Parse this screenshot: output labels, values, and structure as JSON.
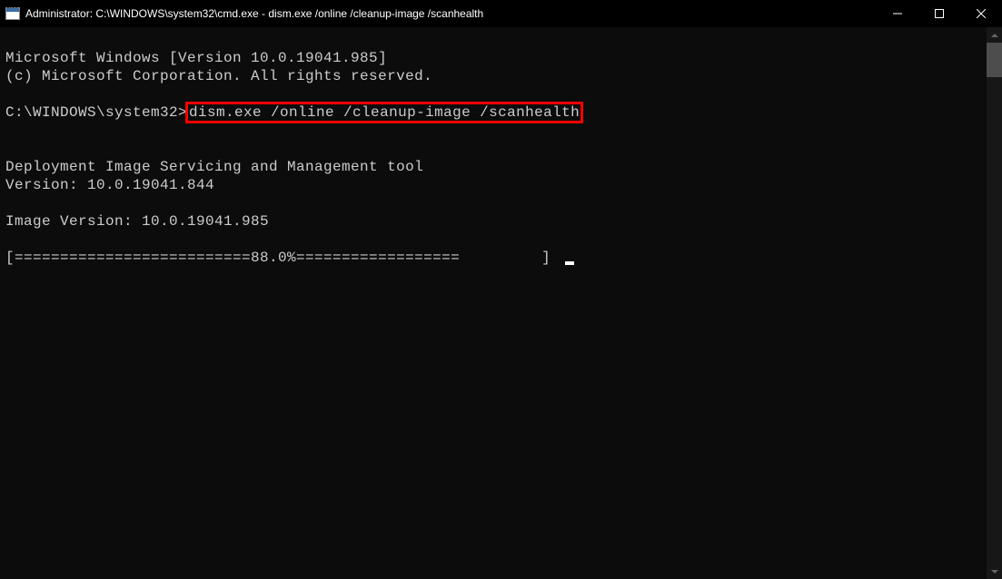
{
  "window": {
    "title": "Administrator: C:\\WINDOWS\\system32\\cmd.exe - dism.exe  /online /cleanup-image /scanhealth"
  },
  "terminal": {
    "line1": "Microsoft Windows [Version 10.0.19041.985]",
    "line2": "(c) Microsoft Corporation. All rights reserved.",
    "prompt": "C:\\WINDOWS\\system32>",
    "command": "dism.exe /online /cleanup-image /scanhealth",
    "tool_name": "Deployment Image Servicing and Management tool",
    "tool_version": "Version: 10.0.19041.844",
    "image_version": "Image Version: 10.0.19041.985",
    "progress_line": "[==========================88.0%==================         ] "
  }
}
